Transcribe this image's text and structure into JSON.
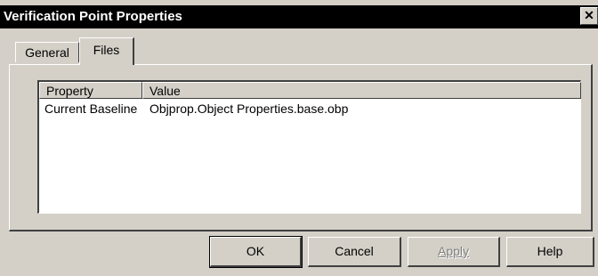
{
  "window": {
    "title": "Verification Point Properties",
    "close_glyph": "✕"
  },
  "tabs": [
    {
      "label": "General"
    },
    {
      "label": "Files"
    }
  ],
  "list": {
    "columns": [
      {
        "label": "Property"
      },
      {
        "label": "Value"
      }
    ],
    "rows": [
      {
        "property": "Current Baseline",
        "value": "Objprop.Object Properties.base.obp"
      }
    ]
  },
  "buttons": {
    "ok": "OK",
    "cancel": "Cancel",
    "apply": "Apply",
    "help": "Help"
  }
}
